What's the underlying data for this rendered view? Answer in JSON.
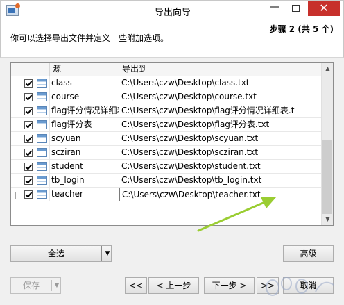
{
  "window": {
    "title": "导出向导",
    "close_glyph": "✕",
    "min_glyph": "—"
  },
  "header": {
    "step": "步骤 2 (共 5 个)",
    "instruction": "你可以选择导出文件并定义一些附加选项。"
  },
  "table": {
    "columns": [
      "源",
      "导出到"
    ],
    "rows": [
      {
        "source": "class",
        "target": "C:\\Users\\czw\\Desktop\\class.txt",
        "checked": true
      },
      {
        "source": "course",
        "target": "C:\\Users\\czw\\Desktop\\course.txt",
        "checked": true
      },
      {
        "source": "flag评分情况详细表",
        "target": "C:\\Users\\czw\\Desktop\\flag评分情况详细表.t",
        "checked": true
      },
      {
        "source": "flag评分表",
        "target": "C:\\Users\\czw\\Desktop\\flag评分表.txt",
        "checked": true
      },
      {
        "source": "scyuan",
        "target": "C:\\Users\\czw\\Desktop\\scyuan.txt",
        "checked": true
      },
      {
        "source": "scziran",
        "target": "C:\\Users\\czw\\Desktop\\scziran.txt",
        "checked": true
      },
      {
        "source": "student",
        "target": "C:\\Users\\czw\\Desktop\\student.txt",
        "checked": true
      },
      {
        "source": "tb_login",
        "target": "C:\\Users\\czw\\Desktop\\tb_login.txt",
        "checked": true
      },
      {
        "source": "teacher",
        "target": "C:\\Users\\czw\\Desktop\\teacher.txt",
        "checked": true
      }
    ],
    "browse_label": "…",
    "row_cursor": "I"
  },
  "buttons": {
    "select_all": "全选",
    "advanced": "高级",
    "save": "保存",
    "first": "<<",
    "prev": "< 上一步",
    "next": "下一步 >",
    "last": ">>",
    "cancel": "取消"
  },
  "colors": {
    "close": "#c7302b",
    "arrow": "#9acd32"
  }
}
